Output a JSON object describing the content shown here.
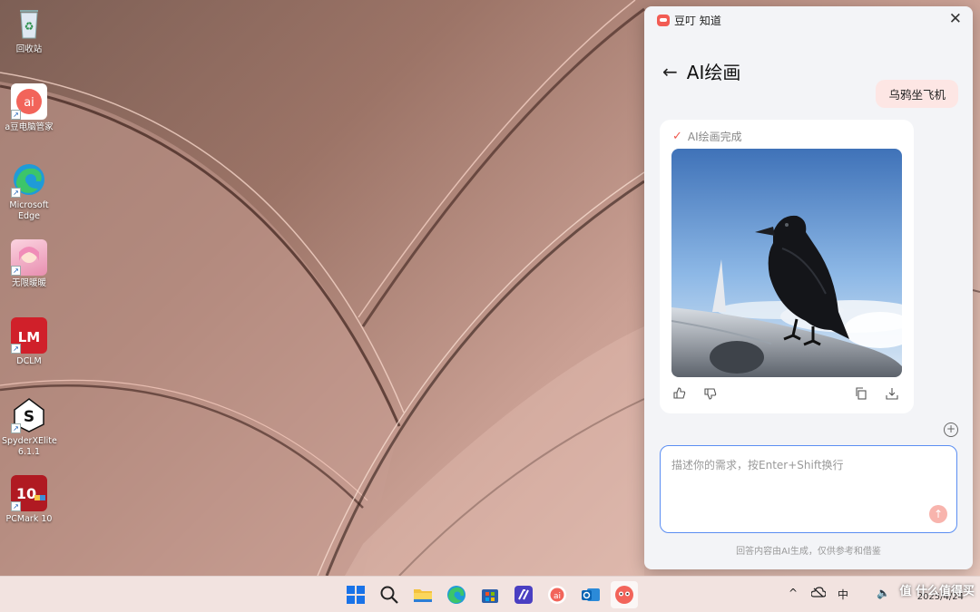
{
  "desktop": {
    "icons": [
      {
        "label": "回收站",
        "icon": "recycle-bin-icon"
      },
      {
        "label": "a豆电脑管家",
        "icon": "app-manager-icon"
      },
      {
        "label": "Microsoft Edge",
        "icon": "edge-icon"
      },
      {
        "label": "无限暖暖",
        "icon": "game-icon"
      },
      {
        "label": "DCLM",
        "icon": "dclm-icon"
      },
      {
        "label": "SpyderXElite 6.1.1",
        "icon": "spyder-icon"
      },
      {
        "label": "PCMark 10",
        "icon": "pcmark-icon"
      }
    ]
  },
  "panel": {
    "app_title": "豆叮 知道",
    "page_title": "AI绘画",
    "user_message": "乌鸦坐飞机",
    "status": "AI绘画完成",
    "input_placeholder": "描述你的需求，按Enter+Shift换行",
    "footnote": "回答内容由AI生成，仅供参考和借鉴"
  },
  "taskbar": {
    "apps": [
      "start-icon",
      "search-icon",
      "file-explorer-icon",
      "edge-icon",
      "store-icon",
      "vs-code-icon",
      "doubao-app-icon",
      "outlook-icon",
      "doubao-active-icon"
    ],
    "tray": {
      "ime": "中"
    },
    "date": "2025/4/24"
  },
  "watermark": "值 什么值得买",
  "colors": {
    "accent": "#5b8ef2",
    "brand": "#f25c54",
    "bubble": "#fde6e4"
  }
}
